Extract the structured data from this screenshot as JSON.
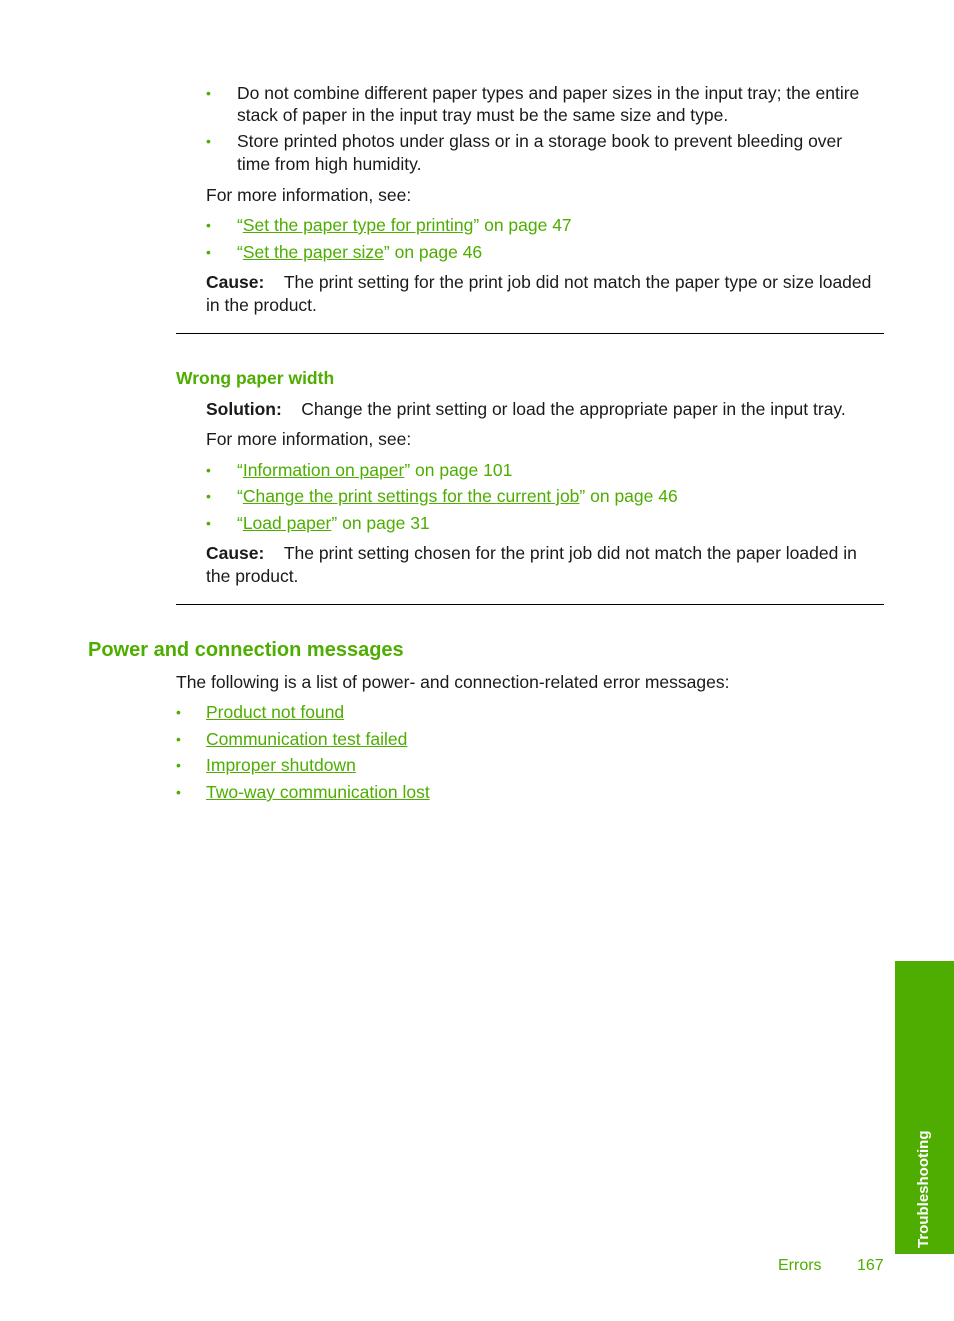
{
  "top_section": {
    "bullets": [
      {
        "line1": "Do not combine different paper types and paper sizes in the input tray; the entire",
        "line2": "stack of paper in the input tray must be the same size and type."
      },
      {
        "line1": "Store printed photos under glass or in a storage book to prevent bleeding over",
        "line2": "time from high humidity."
      }
    ],
    "more_info": "For more information, see:",
    "links": [
      {
        "open": "“",
        "link": "Set the paper type for printing",
        "rest": "” on page 47"
      },
      {
        "open": "“",
        "link": "Set the paper size",
        "rest": "” on page 46"
      }
    ],
    "cause_label": "Cause:",
    "cause_line1": "The print setting for the print job did not match the paper type or size loaded",
    "cause_line2": "in the product."
  },
  "wrong_width": {
    "heading": "Wrong paper width",
    "solution_label": "Solution:",
    "solution_text": "Change the print setting or load the appropriate paper in the input tray.",
    "more_info": "For more information, see:",
    "links": [
      {
        "open": "“",
        "link": "Information on paper",
        "rest": "” on page 101"
      },
      {
        "open": "“",
        "link": "Change the print settings for the current job",
        "rest": "” on page 46"
      },
      {
        "open": "“",
        "link": "Load paper",
        "rest": "” on page 31"
      }
    ],
    "cause_label": "Cause:",
    "cause_line1": "The print setting chosen for the print job did not match the paper loaded in",
    "cause_line2": "the product."
  },
  "power_section": {
    "heading": "Power and connection messages",
    "intro": "The following is a list of power- and connection-related error messages:",
    "links": [
      "Product not found",
      "Communication test failed",
      "Improper shutdown",
      "Two-way communication lost"
    ]
  },
  "side_tab": {
    "label": "Troubleshooting"
  },
  "footer": {
    "section": "Errors",
    "page": "167"
  },
  "bullet_glyph": "•"
}
